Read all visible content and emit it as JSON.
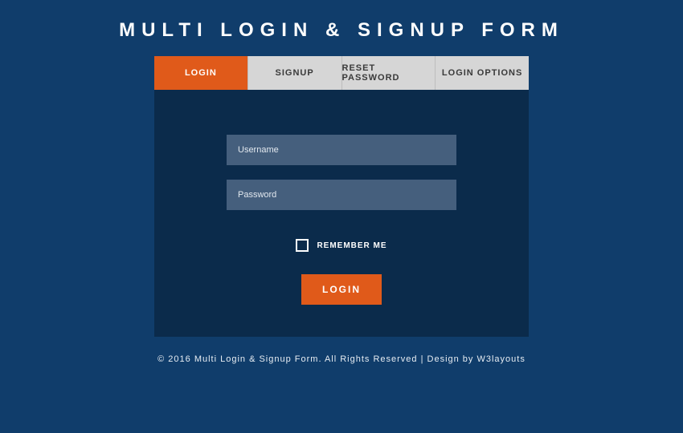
{
  "title": "MULTI LOGIN & SIGNUP FORM",
  "tabs": [
    {
      "label": "LOGIN",
      "active": true
    },
    {
      "label": "SIGNUP",
      "active": false
    },
    {
      "label": "RESET PASSWORD",
      "active": false
    },
    {
      "label": "LOGIN OPTIONS",
      "active": false
    }
  ],
  "form": {
    "username_placeholder": "Username",
    "password_placeholder": "Password",
    "remember_label": "REMEMBER ME",
    "submit_label": "LOGIN"
  },
  "footer": "© 2016 Multi Login & Signup Form. All Rights Reserved | Design by W3layouts",
  "colors": {
    "page_bg": "#103d6b",
    "card_bg": "#0b2b4b",
    "accent": "#e05a1a",
    "tab_inactive_bg": "#d6d6d6",
    "input_bg": "#455f7d"
  }
}
